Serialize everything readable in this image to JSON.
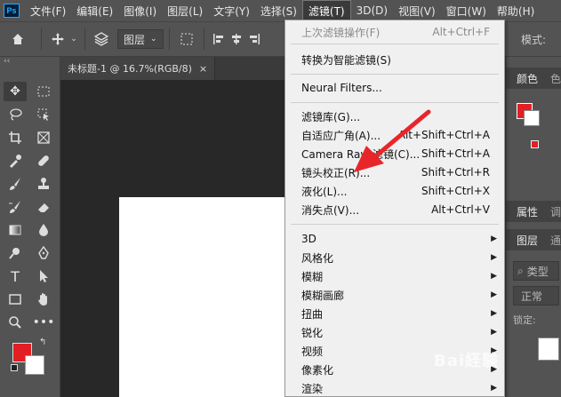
{
  "app": {
    "logo_text": "Ps"
  },
  "menubar": {
    "items": [
      "文件(F)",
      "编辑(E)",
      "图像(I)",
      "图层(L)",
      "文字(Y)",
      "选择(S)",
      "滤镜(T)",
      "3D(D)",
      "视图(V)",
      "窗口(W)",
      "帮助(H)"
    ],
    "active_index": 6
  },
  "options": {
    "auto_select_value": "图层",
    "mode_label": "模式:"
  },
  "tab": {
    "title": "未标题-1 @ 16.7%(RGB/8)",
    "close": "×"
  },
  "toolbar": {
    "collapse": "‹‹",
    "tools": [
      "move-icon",
      "marquee-icon",
      "lasso-icon",
      "object-select-icon",
      "crop-icon",
      "frame-icon",
      "eyedropper-icon",
      "healing-icon",
      "brush-icon",
      "stamp-icon",
      "history-brush-icon",
      "eraser-icon",
      "gradient-icon",
      "blur-icon",
      "dodge-icon",
      "pen-icon",
      "type-icon",
      "path-select-icon",
      "rectangle-icon",
      "hand-icon",
      "zoom-icon",
      "more-icon"
    ],
    "foreground_color": "#e31e24",
    "background_color": "#ffffff"
  },
  "filter_menu": {
    "last_filter": {
      "label": "上次滤镜操作(F)",
      "shortcut": "Alt+Ctrl+F"
    },
    "convert_smart": "转换为智能滤镜(S)",
    "neural": "Neural Filters...",
    "group1": [
      {
        "label": "滤镜库(G)...",
        "shortcut": ""
      },
      {
        "label": "自适应广角(A)...",
        "shortcut": "Alt+Shift+Ctrl+A"
      },
      {
        "label": "Camera Raw 滤镜(C)...",
        "shortcut": "Shift+Ctrl+A"
      },
      {
        "label": "镜头校正(R)...",
        "shortcut": "Shift+Ctrl+R"
      },
      {
        "label": "液化(L)...",
        "shortcut": "Shift+Ctrl+X"
      },
      {
        "label": "消失点(V)...",
        "shortcut": "Alt+Ctrl+V"
      }
    ],
    "submenus": [
      "3D",
      "风格化",
      "模糊",
      "模糊画廊",
      "扭曲",
      "锐化",
      "视频",
      "像素化",
      "渲染"
    ]
  },
  "right_panel": {
    "color_tab": "颜色",
    "color_tab2": "色",
    "properties_tab": "属性",
    "properties_tab2": "调",
    "layers_tab": "图层",
    "layers_tab2": "通",
    "search_placeholder": "类型",
    "blend_mode": "正常",
    "lock_label": "锁定:",
    "annotation_color": "#e8262a"
  },
  "watermark": "Bai経験"
}
